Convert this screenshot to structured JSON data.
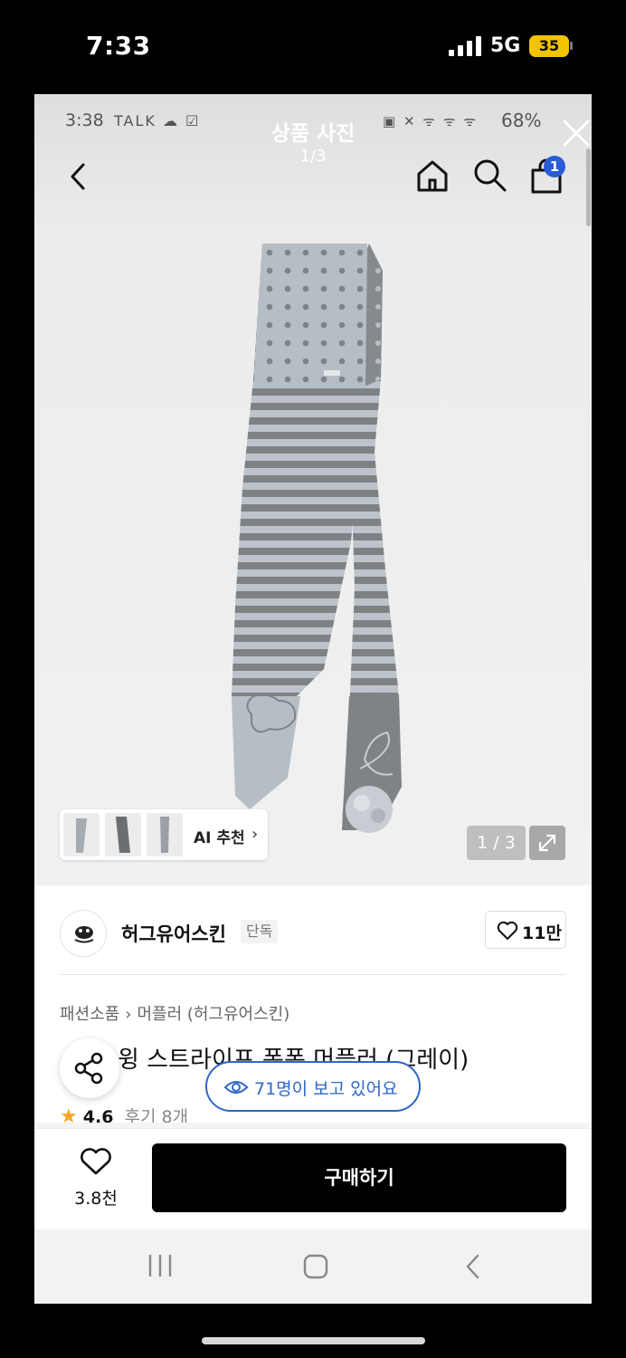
{
  "ios_status": {
    "time": "7:33",
    "network": "5G",
    "battery": "35"
  },
  "inner_status": {
    "time": "3:38",
    "left_icons": "TALK ☁ ☑",
    "right_icons": "▣ ✕ ᯤ ᯤ ᯤ",
    "battery": "68%"
  },
  "viewer": {
    "title": "상품 사진",
    "counter_top": "1/3",
    "image_counter": "1 / 3",
    "cart_count": "1",
    "ai_label": "AI 추천",
    "ai_chevron": "›"
  },
  "brand": {
    "name": "허그유어스킨",
    "badge": "단독",
    "likes": "11만"
  },
  "product": {
    "breadcrumb": [
      "패션소품",
      "머플러 (허그유어스킨)"
    ],
    "breadcrumb_sep": "›",
    "title": "윙 스트라이프 폭폭 머플러 (그레이)",
    "viewing": "71명이 보고 있어요",
    "rating": "4.6",
    "reviews": "후기 8개"
  },
  "action_bar": {
    "wish_count": "3.8천",
    "buy_label": "구매하기"
  },
  "icons": [
    "back-icon",
    "home-icon",
    "search-icon",
    "cart-icon",
    "close-icon",
    "expand-icon",
    "heart-icon",
    "share-icon",
    "eye-icon",
    "star-icon"
  ],
  "colors": {
    "accent_blue": "#2f66c8",
    "badge_blue": "#2a5bd7",
    "buy_button": "#000000",
    "star": "#f5a623"
  }
}
